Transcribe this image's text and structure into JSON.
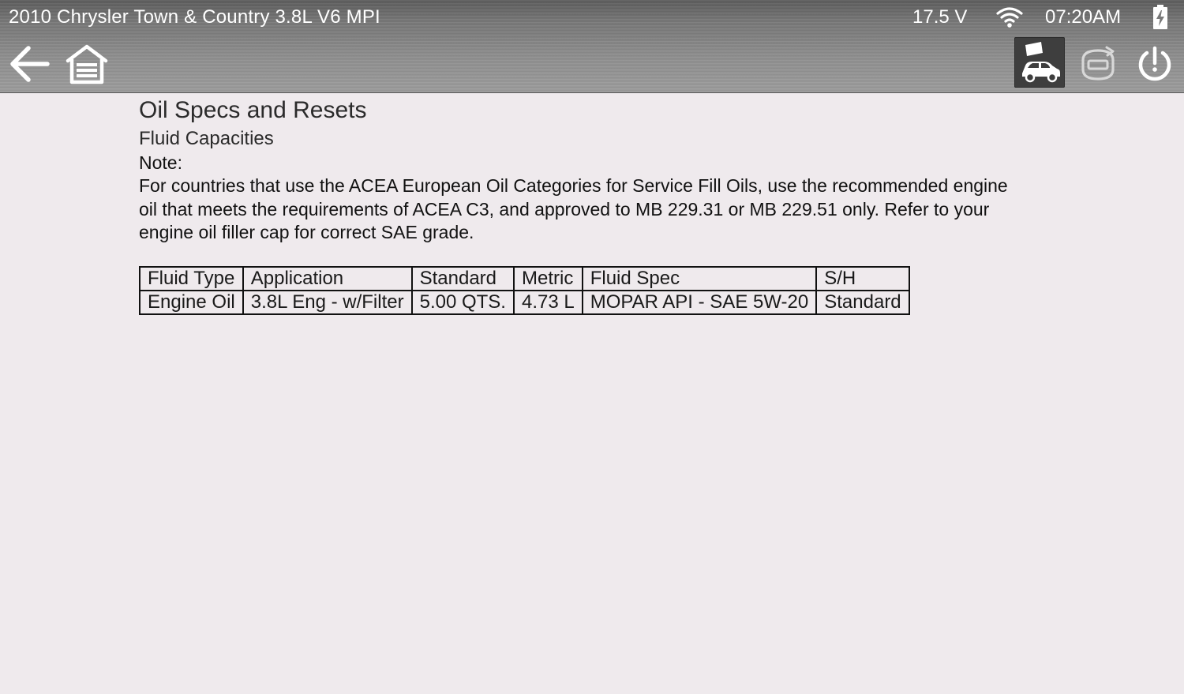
{
  "status_bar": {
    "vehicle": "2010 Chrysler Town & Country 3.8L V6 MPI",
    "voltage": "17.5 V",
    "time": "07:20AM",
    "wifi_icon": "wifi-icon",
    "battery_icon": "battery-charging-icon"
  },
  "toolbar": {
    "back_icon": "back-arrow-icon",
    "home_icon": "garage-home-icon",
    "vehicle_icon": "vehicle-lift-icon",
    "reset_icon": "reset-icon",
    "power_icon": "power-icon",
    "active_color": "#3e3e3e"
  },
  "page": {
    "title": "Oil Specs and Resets",
    "subtitle": "Fluid Capacities",
    "note_label": "Note:",
    "note_text": "For countries that use the ACEA European Oil Categories for Service Fill Oils, use the recommended engine oil that meets the requirements of ACEA C3, and approved to MB 229.31 or MB 229.51 only. Refer to your engine oil filler cap for correct SAE grade."
  },
  "table": {
    "headers": [
      "Fluid Type",
      "Application",
      "Standard",
      "Metric",
      "Fluid Spec",
      "S/H"
    ],
    "rows": [
      [
        "Engine Oil",
        "3.8L Eng - w/Filter",
        "5.00 QTS.",
        "4.73 L",
        "MOPAR API - SAE 5W-20",
        "Standard"
      ]
    ]
  }
}
